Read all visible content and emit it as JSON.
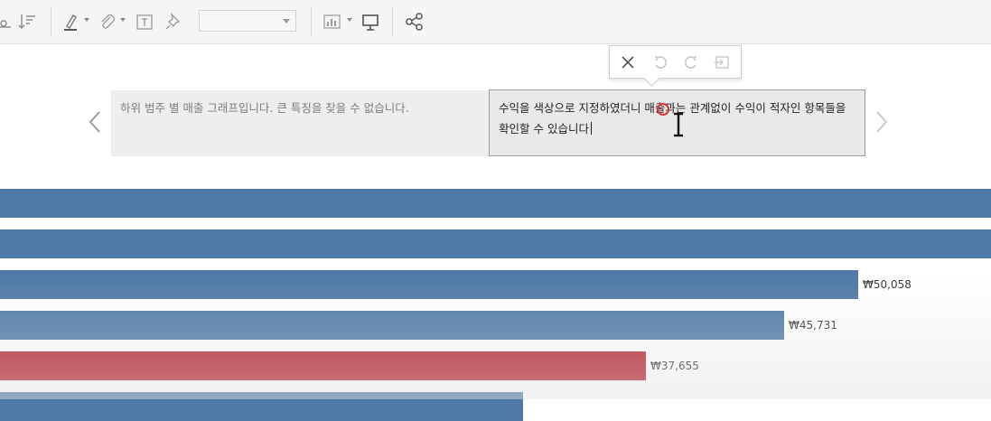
{
  "captions": {
    "previous": "하위 범주 별 매출 그래프입니다. 큰 특징을 찾을 수 없습니다.",
    "current": "수익을 색상으로 지정하였더니 매출과는 관계없이 수익이 적자인 항목들을 확인할 수 있습니다"
  },
  "toolbar": {
    "icons": [
      "group-icon",
      "sort-icon",
      "highlighter-icon",
      "attachment-icon",
      "text-box-icon",
      "pin-icon",
      "chart-type-icon",
      "presentation-icon",
      "share-icon"
    ],
    "dropdown_value": ""
  },
  "edit_popup": {
    "icons": [
      "close-icon",
      "undo-icon",
      "redo-icon",
      "insert-icon"
    ]
  },
  "colors": {
    "positive": "#4e79a7",
    "negative": "#b5222f",
    "toolbar_bg": "#f5f5f5"
  },
  "chart_data": {
    "type": "bar",
    "orientation": "horizontal",
    "series": [
      {
        "values": [
          null,
          null,
          50058,
          45731,
          37655,
          null
        ]
      }
    ],
    "data_labels": [
      "",
      "",
      "₩50,058",
      "₩45,731",
      "₩37,655",
      ""
    ],
    "bar_colors": [
      "#4e79a7",
      "#4e79a7",
      "#4e79a7",
      "#4e79a7",
      "#b5222f",
      "#4e79a7"
    ],
    "estimated_values": [
      58000,
      58000,
      50058,
      45731,
      37655,
      30500
    ]
  }
}
